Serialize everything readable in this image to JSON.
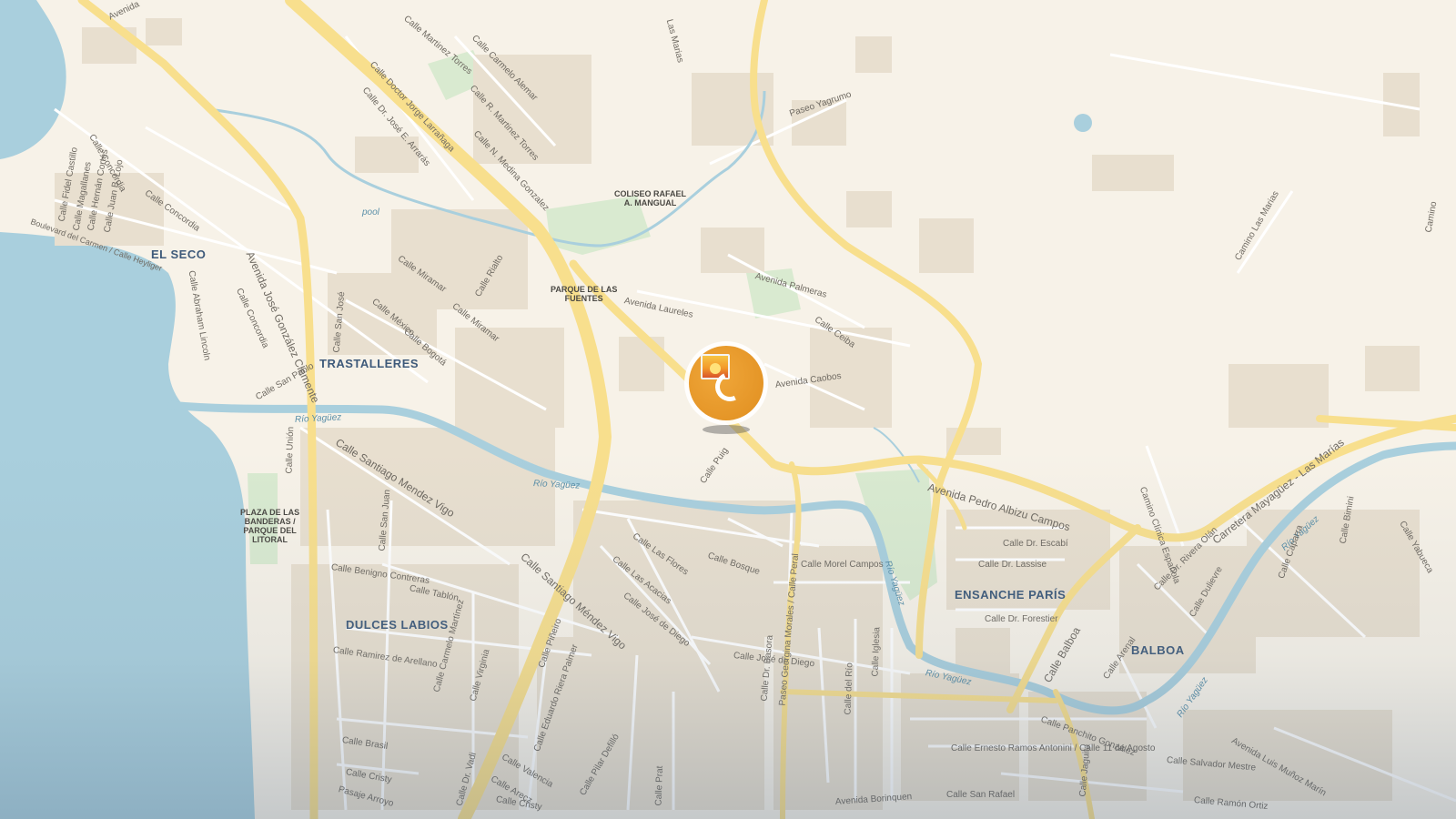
{
  "map": {
    "labels": {
      "neighborhoods": [
        {
          "key": "el_seco",
          "text": "EL SECO"
        },
        {
          "key": "trastalleres",
          "text": "TRASTALLERES"
        },
        {
          "key": "dulces_labios",
          "text": "DULCES LABIOS"
        },
        {
          "key": "ensanche_paris",
          "text": "ENSANCHE PARÍS"
        },
        {
          "key": "balboa",
          "text": "BALBOA"
        }
      ],
      "pois": [
        {
          "key": "coliseo",
          "lines": [
            "COLISEO RAFAEL",
            "A. MANGUAL"
          ]
        },
        {
          "key": "parque_fuentes",
          "lines": [
            "PARQUE DE LAS",
            "FUENTES"
          ]
        },
        {
          "key": "plaza_banderas",
          "lines": [
            "PLAZA DE LAS",
            "BANDERAS /",
            "PARQUE DEL",
            "LITORAL"
          ]
        }
      ],
      "water": [
        {
          "key": "pool",
          "text": "pool"
        },
        {
          "key": "rio1",
          "text": "Río Yagüez"
        },
        {
          "key": "rio2",
          "text": "Río Yagüez"
        },
        {
          "key": "rio3",
          "text": "Río Yagüez"
        },
        {
          "key": "rio4",
          "text": "Río Yagüez"
        },
        {
          "key": "rio5",
          "text": "Río Yagüez"
        },
        {
          "key": "rio6",
          "text": "Río Yagüez"
        }
      ],
      "streets": [
        {
          "key": "s_avenida_top",
          "text": "Avenida"
        },
        {
          "key": "s_martinez_torres",
          "text": "Calle Martinez Torres"
        },
        {
          "key": "s_carmelo_alemar",
          "text": "Calle Carmelo Alemar"
        },
        {
          "key": "s_larranaga",
          "text": "Calle Doctor Jorge Larrañaga"
        },
        {
          "key": "s_arraras",
          "text": "Calle Dr. José E. Arrarás"
        },
        {
          "key": "s_r_martinez",
          "text": "Calle R. Martinez Torres"
        },
        {
          "key": "s_medina",
          "text": "Calle N. Medina Gonzalez"
        },
        {
          "key": "s_las_marias_top",
          "text": "Las Marias"
        },
        {
          "key": "s_yagrumo",
          "text": "Paseo Yagrumo"
        },
        {
          "key": "s_concordia1",
          "text": "Calle Concordia"
        },
        {
          "key": "s_concordia2",
          "text": "Calle Concordia"
        },
        {
          "key": "s_concordia3",
          "text": "Calle Concordia"
        },
        {
          "key": "s_jose_gonzalez_clemente",
          "text": "Avenida José González Clemente"
        },
        {
          "key": "s_fidel",
          "text": "Calle Fidel Castillo"
        },
        {
          "key": "s_magallanes",
          "text": "Calle Magallanes"
        },
        {
          "key": "s_hernan",
          "text": "Calle Hernán Cortés"
        },
        {
          "key": "s_juan_lojo",
          "text": "Calle Juan B. Lojo"
        },
        {
          "key": "s_boulevard",
          "text": "Boulevard del Carmen / Calle Heyliger"
        },
        {
          "key": "s_abraham",
          "text": "Calle Abraham Lincoln"
        },
        {
          "key": "s_miramar1",
          "text": "Calle Miramar"
        },
        {
          "key": "s_miramar2",
          "text": "Calle Miramar"
        },
        {
          "key": "s_rialto",
          "text": "Calle Rialto"
        },
        {
          "key": "s_mexico",
          "text": "Calle México"
        },
        {
          "key": "s_bogota",
          "text": "Calle Bogotá"
        },
        {
          "key": "s_san_jose",
          "text": "Calle San José"
        },
        {
          "key": "s_san_pablo",
          "text": "Calle San Pablo"
        },
        {
          "key": "s_palmeras",
          "text": "Avenida Palmeras"
        },
        {
          "key": "s_laureles",
          "text": "Avenida Laureles"
        },
        {
          "key": "s_ceiba",
          "text": "Calle Ceiba"
        },
        {
          "key": "s_caobos",
          "text": "Avenida Caobos"
        },
        {
          "key": "s_puig",
          "text": "Calle Puig"
        },
        {
          "key": "s_union",
          "text": "Calle Unión"
        },
        {
          "key": "s_santiago1",
          "text": "Calle Santiago Mendez Vigo"
        },
        {
          "key": "s_santiago2",
          "text": "Calle Santiago Méndez Vigo"
        },
        {
          "key": "s_san_juan",
          "text": "Calle San Juan"
        },
        {
          "key": "s_benigno",
          "text": "Calle Benigno Contreras"
        },
        {
          "key": "s_tablon",
          "text": "Calle Tablón"
        },
        {
          "key": "s_ramirez",
          "text": "Calle Ramirez de Arellano"
        },
        {
          "key": "s_las_flores",
          "text": "Calle Las Flores"
        },
        {
          "key": "s_acacias",
          "text": "Calle Las Acacias"
        },
        {
          "key": "s_jose_diego1",
          "text": "Calle José de Diego"
        },
        {
          "key": "s_jose_diego2",
          "text": "Calle José de Diego"
        },
        {
          "key": "s_bosque",
          "text": "Calle Bosque"
        },
        {
          "key": "s_morel",
          "text": "Calle Morel Campos"
        },
        {
          "key": "s_pedro_albizu",
          "text": "Avenida Pedro Albizu Campos"
        },
        {
          "key": "s_escabi",
          "text": "Calle Dr. Escabí"
        },
        {
          "key": "s_lassise",
          "text": "Calle Dr. Lassise"
        },
        {
          "key": "s_forestier",
          "text": "Calle Dr. Forestier"
        },
        {
          "key": "s_carretera",
          "text": "Carretera Mayagüez - Las Marías"
        },
        {
          "key": "s_camino_clinica",
          "text": "Camino Clínica Española"
        },
        {
          "key": "s_camino_marias",
          "text": "Camino Las Marias"
        },
        {
          "key": "s_camino_right",
          "text": "Camino"
        },
        {
          "key": "s_rivera_olan",
          "text": "Calle Dr. Rivera Olán"
        },
        {
          "key": "s_dulievre",
          "text": "Calle Dulievre"
        },
        {
          "key": "s_caparra",
          "text": "Calle Caparra"
        },
        {
          "key": "s_bimini",
          "text": "Calle Bimini"
        },
        {
          "key": "s_yabueca",
          "text": "Calle Yabueca"
        },
        {
          "key": "s_balboa",
          "text": "Calle Balboa"
        },
        {
          "key": "s_arenal",
          "text": "Calle Arenal"
        },
        {
          "key": "s_panchito",
          "text": "Calle Panchito González"
        },
        {
          "key": "s_ernesto",
          "text": "Calle Ernesto Ramos Antonini / Calle 11 de Agosto"
        },
        {
          "key": "s_salvador",
          "text": "Calle Salvador Mestre"
        },
        {
          "key": "s_luis_munoz",
          "text": "Avenida Luis Muñoz Marín"
        },
        {
          "key": "s_ramon_ortiz",
          "text": "Calle Ramón Ortiz"
        },
        {
          "key": "s_san_rafael",
          "text": "Calle San Rafael"
        },
        {
          "key": "s_borinquen",
          "text": "Avenida Borinquen"
        },
        {
          "key": "s_jaguita",
          "text": "Calle Jaguita"
        },
        {
          "key": "s_dr_basora",
          "text": "Calle Dr. Basora"
        },
        {
          "key": "s_georgina",
          "text": "Paseo Georgina Morales / Calle Peral"
        },
        {
          "key": "s_del_rio",
          "text": "Calle del Río"
        },
        {
          "key": "s_iglesia",
          "text": "Calle Iglesia"
        },
        {
          "key": "s_carmelo_martinez",
          "text": "Calle Carmelo Martínez"
        },
        {
          "key": "s_virginia",
          "text": "Calle Virginia"
        },
        {
          "key": "s_pinero",
          "text": "Calle Piñeiro"
        },
        {
          "key": "s_eduardo",
          "text": "Calle Eduardo Riera Palmer"
        },
        {
          "key": "s_valencia",
          "text": "Calle Valencia"
        },
        {
          "key": "s_arecz",
          "text": "Calle Arecz"
        },
        {
          "key": "s_cristy1",
          "text": "Calle Cristy"
        },
        {
          "key": "s_cristy2",
          "text": "Calle Cristy"
        },
        {
          "key": "s_brasil",
          "text": "Calle Brasil"
        },
        {
          "key": "s_pasaje_arroyo",
          "text": "Pasaje Arroyo"
        },
        {
          "key": "s_vadi",
          "text": "Calle Dr. Vadi"
        },
        {
          "key": "s_pilar",
          "text": "Calle Pilar Defilló"
        },
        {
          "key": "s_prat",
          "text": "Calle Prat"
        }
      ]
    },
    "marker": {
      "icon": "image-placeholder-icon",
      "state": "loading",
      "accent": "#e8981f"
    },
    "colors": {
      "land": "#f7f2e8",
      "water": "#a9cfdd",
      "park": "#d9ead0",
      "major_road": "#f8df8d",
      "road": "#ffffff",
      "building": "#e6ddcd"
    }
  }
}
